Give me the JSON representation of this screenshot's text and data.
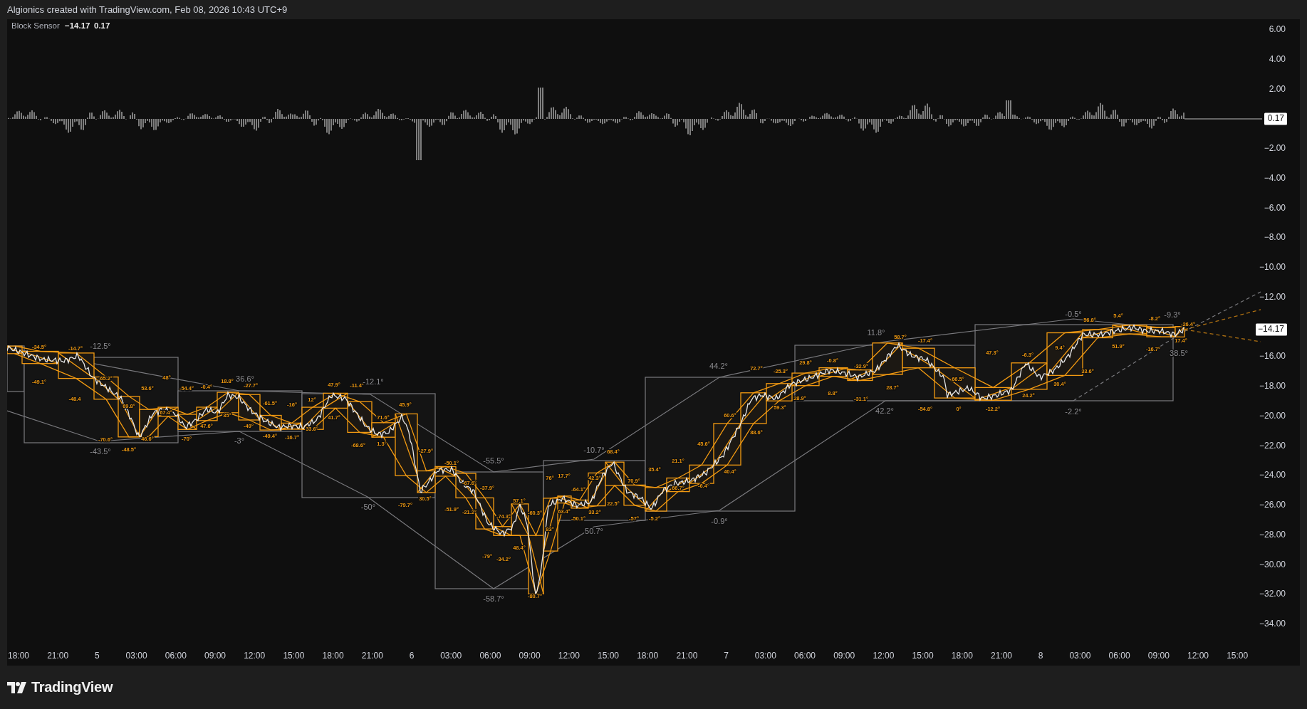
{
  "header": {
    "attribution": "Algionics created with TradingView.com, Feb 08, 2026 10:43 UTC+9"
  },
  "legend": {
    "name": "Block Sensor",
    "values": [
      "−14.17",
      "0.17"
    ]
  },
  "chart": {
    "angle_labels": [
      {
        "text": "-34.5°",
        "kind": "block"
      },
      {
        "text": "-14.7°",
        "kind": "block"
      },
      {
        "text": "-12.5°",
        "kind": "trend"
      },
      {
        "text": "-49.1°",
        "kind": "block"
      },
      {
        "text": "-65.2°",
        "kind": "block"
      },
      {
        "text": "-48.4",
        "kind": "block"
      },
      {
        "text": "48°",
        "kind": "block"
      },
      {
        "text": "53.6°",
        "kind": "block"
      },
      {
        "text": "69.8°",
        "kind": "block"
      },
      {
        "text": "67.4°",
        "kind": "block"
      },
      {
        "text": "-70.6°",
        "kind": "block"
      },
      {
        "text": "46.6°",
        "kind": "block"
      },
      {
        "text": "-43.5°",
        "kind": "trend"
      },
      {
        "text": "-48.5°",
        "kind": "block"
      },
      {
        "text": "-54.4°",
        "kind": "block"
      },
      {
        "text": "-0.4°",
        "kind": "block"
      },
      {
        "text": "18.8°",
        "kind": "block"
      },
      {
        "text": "36.6°",
        "kind": "trend"
      },
      {
        "text": "-27.7°",
        "kind": "block"
      },
      {
        "text": "-70°",
        "kind": "block"
      },
      {
        "text": "47.6°",
        "kind": "block"
      },
      {
        "text": "35°",
        "kind": "block"
      },
      {
        "text": "-49°",
        "kind": "block"
      },
      {
        "text": "-3°",
        "kind": "trend"
      },
      {
        "text": "-61.5°",
        "kind": "block"
      },
      {
        "text": "-16°",
        "kind": "block"
      },
      {
        "text": "-49.4°",
        "kind": "block"
      },
      {
        "text": "-16.7°",
        "kind": "block"
      },
      {
        "text": "12°",
        "kind": "block"
      },
      {
        "text": "33.6°",
        "kind": "block"
      },
      {
        "text": "47.9°",
        "kind": "block"
      },
      {
        "text": "41.7°",
        "kind": "block"
      },
      {
        "text": "-11.4°",
        "kind": "block"
      },
      {
        "text": "-12.1°",
        "kind": "trend"
      },
      {
        "text": "-68.6°",
        "kind": "block"
      },
      {
        "text": "71.6°",
        "kind": "block"
      },
      {
        "text": "1.3°",
        "kind": "block"
      },
      {
        "text": "45.9°",
        "kind": "block"
      },
      {
        "text": "-50°",
        "kind": "trend"
      },
      {
        "text": "-79.7°",
        "kind": "block"
      },
      {
        "text": "-27.9°",
        "kind": "block"
      },
      {
        "text": "30.5°",
        "kind": "block"
      },
      {
        "text": "-50.1°",
        "kind": "block"
      },
      {
        "text": "-51.9°",
        "kind": "block"
      },
      {
        "text": "-55.5°",
        "kind": "trend"
      },
      {
        "text": "-67.6°",
        "kind": "block"
      },
      {
        "text": "-21.2°",
        "kind": "block"
      },
      {
        "text": "-37.9°",
        "kind": "block"
      },
      {
        "text": "-79°",
        "kind": "block"
      },
      {
        "text": "-74.3°",
        "kind": "block"
      },
      {
        "text": "-34.2°",
        "kind": "block"
      },
      {
        "text": "57.1°",
        "kind": "block"
      },
      {
        "text": "48.4°",
        "kind": "block"
      },
      {
        "text": "-60.3°",
        "kind": "block"
      },
      {
        "text": "-80.7°",
        "kind": "block"
      },
      {
        "text": "-58.7°",
        "kind": "trend"
      },
      {
        "text": "76°",
        "kind": "block"
      },
      {
        "text": "83°",
        "kind": "block"
      },
      {
        "text": "17.7°",
        "kind": "block"
      },
      {
        "text": "63.4°",
        "kind": "block"
      },
      {
        "text": "-10.7°",
        "kind": "trend"
      },
      {
        "text": "-64.1°",
        "kind": "block"
      },
      {
        "text": "-50.1°",
        "kind": "block"
      },
      {
        "text": "42.3°",
        "kind": "block"
      },
      {
        "text": "33.2°",
        "kind": "block"
      },
      {
        "text": "50.7°",
        "kind": "trend"
      },
      {
        "text": "68.4°",
        "kind": "block"
      },
      {
        "text": "22.5°",
        "kind": "block"
      },
      {
        "text": "70.9°",
        "kind": "block"
      },
      {
        "text": "-57°",
        "kind": "block"
      },
      {
        "text": "35.4°",
        "kind": "block"
      },
      {
        "text": "-5.2°",
        "kind": "block"
      },
      {
        "text": "21.1°",
        "kind": "block"
      },
      {
        "text": "66.7°",
        "kind": "block"
      },
      {
        "text": "44.2°",
        "kind": "trend"
      },
      {
        "text": "45.6°",
        "kind": "block"
      },
      {
        "text": "-6.4°",
        "kind": "block"
      },
      {
        "text": "60.6°",
        "kind": "block"
      },
      {
        "text": "40.4°",
        "kind": "block"
      },
      {
        "text": "-0.9°",
        "kind": "trend"
      },
      {
        "text": "72.7°",
        "kind": "block"
      },
      {
        "text": "88.6°",
        "kind": "block"
      },
      {
        "text": "-25.3°",
        "kind": "block"
      },
      {
        "text": "59.3°",
        "kind": "block"
      },
      {
        "text": "29.8°",
        "kind": "block"
      },
      {
        "text": "28.9°",
        "kind": "block"
      },
      {
        "text": "-0.8°",
        "kind": "block"
      },
      {
        "text": "8.8°",
        "kind": "block"
      },
      {
        "text": "-32.9°",
        "kind": "block"
      },
      {
        "text": "-31.1°",
        "kind": "block"
      },
      {
        "text": "11.8°",
        "kind": "trend"
      },
      {
        "text": "58.7°",
        "kind": "block"
      },
      {
        "text": "28.7°",
        "kind": "block"
      },
      {
        "text": "42.2°",
        "kind": "trend"
      },
      {
        "text": "-17.4°",
        "kind": "block"
      },
      {
        "text": "-54.8°",
        "kind": "block"
      },
      {
        "text": "66.5°",
        "kind": "block"
      },
      {
        "text": "0°",
        "kind": "block"
      },
      {
        "text": "47.3°",
        "kind": "block"
      },
      {
        "text": "-12.2°",
        "kind": "block"
      },
      {
        "text": "-6.3°",
        "kind": "block"
      },
      {
        "text": "24.2°",
        "kind": "block"
      },
      {
        "text": "9.4°",
        "kind": "block"
      },
      {
        "text": "30.4°",
        "kind": "block"
      },
      {
        "text": "-0.5°",
        "kind": "trend"
      },
      {
        "text": "-2.2°",
        "kind": "trend"
      },
      {
        "text": "56.8°",
        "kind": "block"
      },
      {
        "text": "33.6°",
        "kind": "block"
      },
      {
        "text": "5.4°",
        "kind": "block"
      },
      {
        "text": "51.9°",
        "kind": "block"
      },
      {
        "text": "-8.2°",
        "kind": "block"
      },
      {
        "text": "-16.7°",
        "kind": "block"
      },
      {
        "text": "-9.3°",
        "kind": "trend"
      },
      {
        "text": "-26.4°",
        "kind": "block"
      },
      {
        "text": "17.4°",
        "kind": "block"
      },
      {
        "text": "38.5°",
        "kind": "trend"
      }
    ],
    "price_labels": [
      "6.00",
      "4.00",
      "2.00",
      "−2.00",
      "−4.00",
      "−6.00",
      "−8.00",
      "−10.00",
      "−12.00",
      "−16.00",
      "−18.00",
      "−20.00",
      "−22.00",
      "−24.00",
      "−26.00",
      "−28.00",
      "−30.00",
      "−32.00",
      "−34.00"
    ],
    "price_badges": [
      "0.17",
      "−14.17"
    ],
    "time_labels": [
      "18:00",
      "21:00",
      "5",
      "03:00",
      "06:00",
      "09:00",
      "12:00",
      "15:00",
      "18:00",
      "21:00",
      "6",
      "03:00",
      "06:00",
      "09:00",
      "12:00",
      "15:00",
      "18:00",
      "21:00",
      "7",
      "03:00",
      "06:00",
      "09:00",
      "12:00",
      "15:00",
      "18:00",
      "21:00",
      "8",
      "03:00",
      "06:00",
      "09:00",
      "12:00",
      "15:00"
    ]
  },
  "footer": {
    "logo_text": "TradingView"
  }
}
